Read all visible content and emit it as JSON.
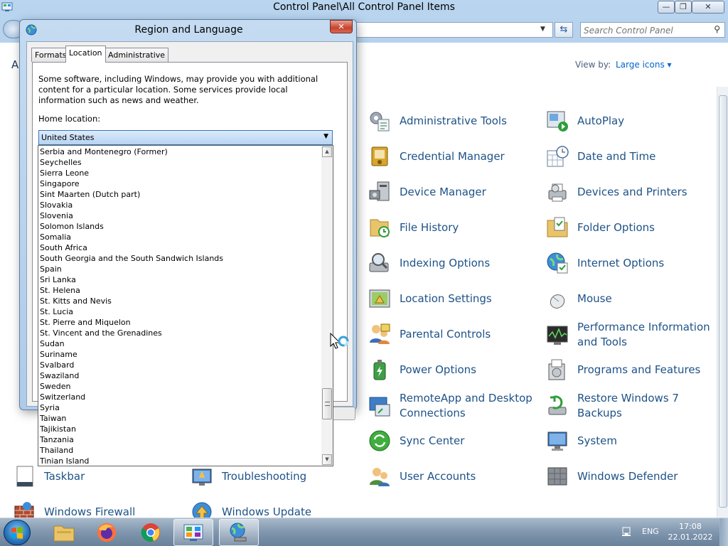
{
  "main_window": {
    "title": "Control Panel\\All Control Panel Items",
    "minimize": "—",
    "maximize": "❐",
    "close": "✕",
    "search_placeholder": "Search Control Panel",
    "refresh_glyph": "⇆",
    "adjust_text": "A",
    "view_by_label": "View by:",
    "view_by_value": "Large icons ▾"
  },
  "items": [
    {
      "label": "Administrative Tools",
      "icon": "administrative-tools-icon"
    },
    {
      "label": "AutoPlay",
      "icon": "autoplay-icon"
    },
    {
      "label": "Credential Manager",
      "icon": "credential-manager-icon"
    },
    {
      "label": "Date and Time",
      "icon": "date-time-icon"
    },
    {
      "label": "Device Manager",
      "icon": "device-manager-icon"
    },
    {
      "label": "Devices and Printers",
      "icon": "printer-icon"
    },
    {
      "label": "File History",
      "icon": "file-history-icon"
    },
    {
      "label": "Folder Options",
      "icon": "folder-options-icon"
    },
    {
      "label": "Indexing Options",
      "icon": "indexing-icon"
    },
    {
      "label": "Internet Options",
      "icon": "internet-options-icon"
    },
    {
      "label": "Location Settings",
      "icon": "location-icon"
    },
    {
      "label": "Mouse",
      "icon": "mouse-icon"
    },
    {
      "label": "Parental Controls",
      "icon": "parental-controls-icon"
    },
    {
      "label": "Performance Information and Tools",
      "icon": "performance-icon"
    },
    {
      "label": "Power Options",
      "icon": "power-icon"
    },
    {
      "label": "Programs and Features",
      "icon": "programs-icon"
    },
    {
      "label": "RemoteApp and Desktop Connections",
      "icon": "remoteapp-icon"
    },
    {
      "label": "Restore Windows 7 Backups",
      "icon": "backup-icon"
    },
    {
      "label": "Sync Center",
      "icon": "sync-icon"
    },
    {
      "label": "System",
      "icon": "system-icon"
    },
    {
      "label": "Taskbar",
      "icon": "taskbar-icon"
    },
    {
      "label": "Troubleshooting",
      "icon": "troubleshooting-icon"
    },
    {
      "label": "User Accounts",
      "icon": "user-accounts-icon"
    },
    {
      "label": "Windows Defender",
      "icon": "defender-icon"
    },
    {
      "label": "Windows Firewall",
      "icon": "firewall-icon"
    },
    {
      "label": "Windows Update",
      "icon": "update-icon"
    }
  ],
  "dialog": {
    "title": "Region and Language",
    "close": "✕",
    "tabs": [
      "Formats",
      "Location",
      "Administrative"
    ],
    "active_tab": "Location",
    "description": "Some software, including Windows, may provide you with additional content for a particular location. Some services provide local information such as news and weather.",
    "home_location_label": "Home location:",
    "home_location_value": "United States",
    "dropdown_items": [
      "Serbia and Montenegro (Former)",
      "Seychelles",
      "Sierra Leone",
      "Singapore",
      "Sint Maarten (Dutch part)",
      "Slovakia",
      "Slovenia",
      "Solomon Islands",
      "Somalia",
      "South Africa",
      "South Georgia and the South Sandwich Islands",
      "Spain",
      "Sri Lanka",
      "St. Helena",
      "St. Kitts and Nevis",
      "St. Lucia",
      "St. Pierre and Miquelon",
      "St. Vincent and the Grenadines",
      "Sudan",
      "Suriname",
      "Svalbard",
      "Swaziland",
      "Sweden",
      "Switzerland",
      "Syria",
      "Taiwan",
      "Tajikistan",
      "Tanzania",
      "Thailand",
      "Tinian Island"
    ]
  },
  "taskbar": {
    "apps": [
      "file-explorer-icon",
      "firefox-icon",
      "chrome-icon",
      "control-panel-icon",
      "region-language-icon"
    ],
    "language": "ENG",
    "time": "17:08",
    "date": "22.01.2022"
  }
}
